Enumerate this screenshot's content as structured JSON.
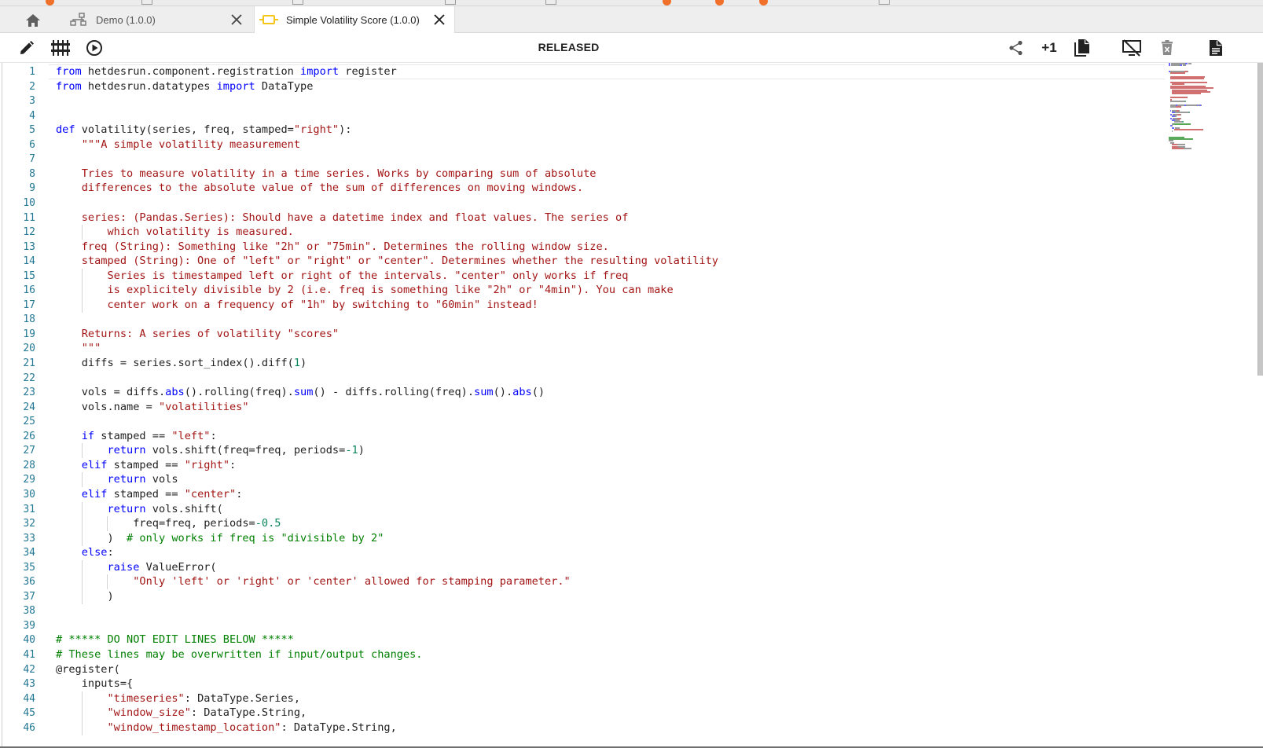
{
  "tabs": [
    {
      "label": "Demo (1.0.0)",
      "icon": "workflow-icon",
      "active": false
    },
    {
      "label": "Simple Volatility Score (1.0.0)",
      "icon": "component-icon",
      "active": true
    }
  ],
  "toolbar": {
    "status": "RELEASED",
    "copy_count": "+1",
    "left_tools": [
      "edit-icon",
      "io-config-icon",
      "execute-icon"
    ],
    "right_tools": [
      "share-icon",
      "copy-icon",
      "hide-preview-icon",
      "delete-icon",
      "documentation-icon"
    ]
  },
  "colors": {
    "keyword": "#0000ff",
    "string": "#a31515",
    "number": "#098658",
    "comment": "#008000",
    "line_number": "#237893",
    "tab_icon": "#f5c518",
    "accent_orange": "#f0702a"
  },
  "editor": {
    "current_line": 1,
    "lines": [
      {
        "n": "1",
        "ind": 0,
        "t": [
          [
            "kw",
            "from"
          ],
          [
            "p",
            " hetdesrun.component.registration "
          ],
          [
            "kw",
            "import"
          ],
          [
            "p",
            " register"
          ]
        ]
      },
      {
        "n": "2",
        "ind": 0,
        "t": [
          [
            "kw",
            "from"
          ],
          [
            "p",
            " hetdesrun.datatypes "
          ],
          [
            "kw",
            "import"
          ],
          [
            "p",
            " DataType"
          ]
        ]
      },
      {
        "n": "3",
        "ind": 0,
        "t": []
      },
      {
        "n": "4",
        "ind": 0,
        "t": []
      },
      {
        "n": "5",
        "ind": 0,
        "t": [
          [
            "kw",
            "def"
          ],
          [
            "p",
            " volatility(series, freq, stamped="
          ],
          [
            "str",
            "\"right\""
          ],
          [
            "p",
            "):"
          ]
        ]
      },
      {
        "n": "6",
        "ind": 1,
        "t": [
          [
            "str",
            "    \"\"\"A simple volatility measurement"
          ]
        ]
      },
      {
        "n": "7",
        "ind": 1,
        "t": []
      },
      {
        "n": "8",
        "ind": 1,
        "t": [
          [
            "str",
            "    Tries to measure volatility in a time series. Works by comparing sum of absolute"
          ]
        ]
      },
      {
        "n": "9",
        "ind": 1,
        "t": [
          [
            "str",
            "    differences to the absolute value of the sum of differences on moving windows."
          ]
        ]
      },
      {
        "n": "10",
        "ind": 1,
        "t": []
      },
      {
        "n": "11",
        "ind": 1,
        "t": [
          [
            "str",
            "    series: (Pandas.Series): Should have a datetime index and float values. The series of"
          ]
        ]
      },
      {
        "n": "12",
        "ind": 2,
        "t": [
          [
            "str",
            "        which volatility is measured."
          ]
        ]
      },
      {
        "n": "13",
        "ind": 1,
        "t": [
          [
            "str",
            "    freq (String): Something like \"2h\" or \"75min\". Determines the rolling window size."
          ]
        ]
      },
      {
        "n": "14",
        "ind": 1,
        "t": [
          [
            "str",
            "    stamped (String): One of \"left\" or \"right\" or \"center\". Determines whether the resulting volatility"
          ]
        ]
      },
      {
        "n": "15",
        "ind": 2,
        "t": [
          [
            "str",
            "        Series is timestamped left or right of the intervals. \"center\" only works if freq"
          ]
        ]
      },
      {
        "n": "16",
        "ind": 2,
        "t": [
          [
            "str",
            "        is explicitely divisible by 2 (i.e. freq is something like \"2h\" or \"4min\"). You can make"
          ]
        ]
      },
      {
        "n": "17",
        "ind": 2,
        "t": [
          [
            "str",
            "        center work on a frequency of \"1h\" by switching to \"60min\" instead!"
          ]
        ]
      },
      {
        "n": "18",
        "ind": 1,
        "t": []
      },
      {
        "n": "19",
        "ind": 1,
        "t": [
          [
            "str",
            "    Returns: A series of volatility \"scores\""
          ]
        ]
      },
      {
        "n": "20",
        "ind": 1,
        "t": [
          [
            "str",
            "    \"\"\""
          ]
        ]
      },
      {
        "n": "21",
        "ind": 1,
        "t": [
          [
            "p",
            "    diffs = series.sort_index().diff("
          ],
          [
            "num",
            "1"
          ],
          [
            "p",
            ")"
          ]
        ]
      },
      {
        "n": "22",
        "ind": 1,
        "t": []
      },
      {
        "n": "23",
        "ind": 1,
        "t": [
          [
            "p",
            "    vols = diffs."
          ],
          [
            "fn",
            "abs"
          ],
          [
            "p",
            "().rolling(freq)."
          ],
          [
            "fn",
            "sum"
          ],
          [
            "p",
            "() - diffs.rolling(freq)."
          ],
          [
            "fn",
            "sum"
          ],
          [
            "p",
            "()."
          ],
          [
            "fn",
            "abs"
          ],
          [
            "p",
            "()"
          ]
        ]
      },
      {
        "n": "24",
        "ind": 1,
        "t": [
          [
            "p",
            "    vols.name = "
          ],
          [
            "str",
            "\"volatilities\""
          ]
        ]
      },
      {
        "n": "25",
        "ind": 1,
        "t": []
      },
      {
        "n": "26",
        "ind": 1,
        "t": [
          [
            "p",
            "    "
          ],
          [
            "kw",
            "if"
          ],
          [
            "p",
            " stamped == "
          ],
          [
            "str",
            "\"left\""
          ],
          [
            "p",
            ":"
          ]
        ]
      },
      {
        "n": "27",
        "ind": 2,
        "t": [
          [
            "p",
            "        "
          ],
          [
            "kw",
            "return"
          ],
          [
            "p",
            " vols.shift(freq=freq, periods="
          ],
          [
            "num",
            "-1"
          ],
          [
            "p",
            ")"
          ]
        ]
      },
      {
        "n": "28",
        "ind": 1,
        "t": [
          [
            "p",
            "    "
          ],
          [
            "kw",
            "elif"
          ],
          [
            "p",
            " stamped == "
          ],
          [
            "str",
            "\"right\""
          ],
          [
            "p",
            ":"
          ]
        ]
      },
      {
        "n": "29",
        "ind": 2,
        "t": [
          [
            "p",
            "        "
          ],
          [
            "kw",
            "return"
          ],
          [
            "p",
            " vols"
          ]
        ]
      },
      {
        "n": "30",
        "ind": 1,
        "t": [
          [
            "p",
            "    "
          ],
          [
            "kw",
            "elif"
          ],
          [
            "p",
            " stamped == "
          ],
          [
            "str",
            "\"center\""
          ],
          [
            "p",
            ":"
          ]
        ]
      },
      {
        "n": "31",
        "ind": 2,
        "t": [
          [
            "p",
            "        "
          ],
          [
            "kw",
            "return"
          ],
          [
            "p",
            " vols.shift("
          ]
        ]
      },
      {
        "n": "32",
        "ind": 3,
        "t": [
          [
            "p",
            "            freq=freq, periods="
          ],
          [
            "num",
            "-0.5"
          ]
        ]
      },
      {
        "n": "33",
        "ind": 2,
        "t": [
          [
            "p",
            "        )  "
          ],
          [
            "com",
            "# only works if freq is \"divisible by 2\""
          ]
        ]
      },
      {
        "n": "34",
        "ind": 1,
        "t": [
          [
            "p",
            "    "
          ],
          [
            "kw",
            "else"
          ],
          [
            "p",
            ":"
          ]
        ]
      },
      {
        "n": "35",
        "ind": 2,
        "t": [
          [
            "p",
            "        "
          ],
          [
            "kw",
            "raise"
          ],
          [
            "p",
            " ValueError("
          ]
        ]
      },
      {
        "n": "36",
        "ind": 3,
        "t": [
          [
            "str",
            "            \"Only 'left' or 'right' or 'center' allowed for stamping parameter.\""
          ]
        ]
      },
      {
        "n": "37",
        "ind": 2,
        "t": [
          [
            "p",
            "        )"
          ]
        ]
      },
      {
        "n": "38",
        "ind": 0,
        "t": []
      },
      {
        "n": "39",
        "ind": 0,
        "t": []
      },
      {
        "n": "40",
        "ind": 0,
        "t": [
          [
            "com",
            "# ***** DO NOT EDIT LINES BELOW *****"
          ]
        ]
      },
      {
        "n": "41",
        "ind": 0,
        "t": [
          [
            "com",
            "# These lines may be overwritten if input/output changes."
          ]
        ]
      },
      {
        "n": "42",
        "ind": 0,
        "t": [
          [
            "p",
            "@register("
          ]
        ]
      },
      {
        "n": "43",
        "ind": 1,
        "t": [
          [
            "p",
            "    inputs={"
          ]
        ]
      },
      {
        "n": "44",
        "ind": 2,
        "t": [
          [
            "p",
            "        "
          ],
          [
            "str",
            "\"timeseries\""
          ],
          [
            "p",
            ": DataType.Series,"
          ]
        ]
      },
      {
        "n": "45",
        "ind": 2,
        "t": [
          [
            "p",
            "        "
          ],
          [
            "str",
            "\"window_size\""
          ],
          [
            "p",
            ": DataType.String,"
          ]
        ]
      },
      {
        "n": "46",
        "ind": 2,
        "t": [
          [
            "p",
            "        "
          ],
          [
            "str",
            "\"window_timestamp_location\""
          ],
          [
            "p",
            ": DataType.String,"
          ]
        ]
      }
    ]
  }
}
